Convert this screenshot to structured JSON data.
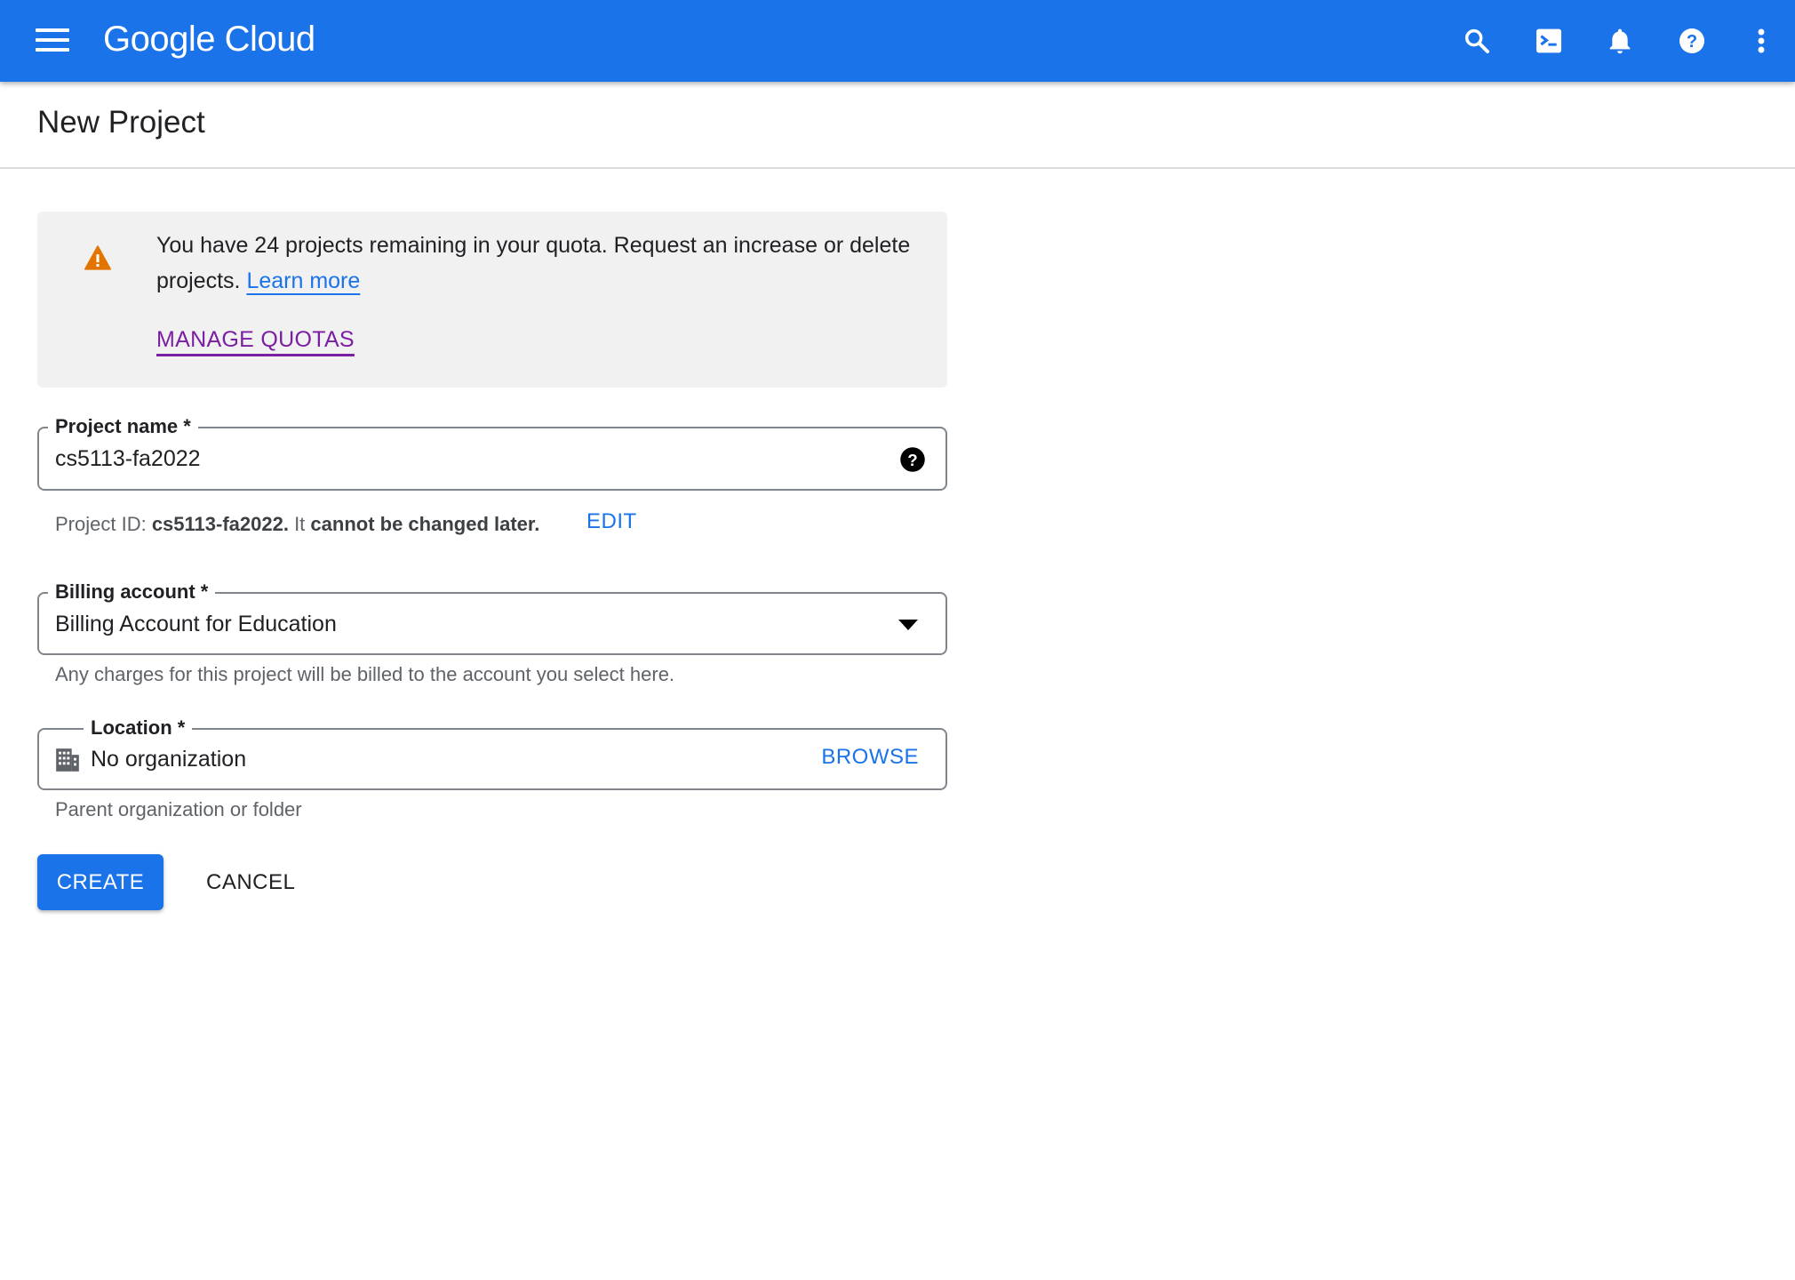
{
  "header": {
    "brand": "Google Cloud",
    "icons": [
      "menu-icon",
      "search-icon",
      "cloud-shell-icon",
      "notifications-icon",
      "help-icon",
      "more-vert-icon"
    ],
    "bar_color": "#1a73e8"
  },
  "page": {
    "title": "New Project"
  },
  "quota_notice": {
    "icon": "warning-icon",
    "icon_color": "#e37400",
    "message": "You have 24 projects remaining in your quota. Request an increase or delete projects.",
    "learn_more": "Learn more",
    "manage_quotas": "MANAGE QUOTAS",
    "projects_remaining": 24
  },
  "form": {
    "project_name": {
      "label": "Project name *",
      "value": "cs5113-fa2022",
      "help_icon": "help-icon"
    },
    "project_id": {
      "prefix": "Project ID: ",
      "id": "cs5113-fa2022.",
      "middle": " It ",
      "emphasis": "cannot be changed later.",
      "edit_label": "EDIT"
    },
    "billing_account": {
      "label": "Billing account *",
      "value": "Billing Account for Education",
      "helper": "Any charges for this project will be billed to the account you select here."
    },
    "location": {
      "label": "Location *",
      "value": "No organization",
      "icon": "organization-icon",
      "browse_label": "BROWSE",
      "helper": "Parent organization or folder"
    }
  },
  "actions": {
    "create": "CREATE",
    "cancel": "CANCEL"
  }
}
